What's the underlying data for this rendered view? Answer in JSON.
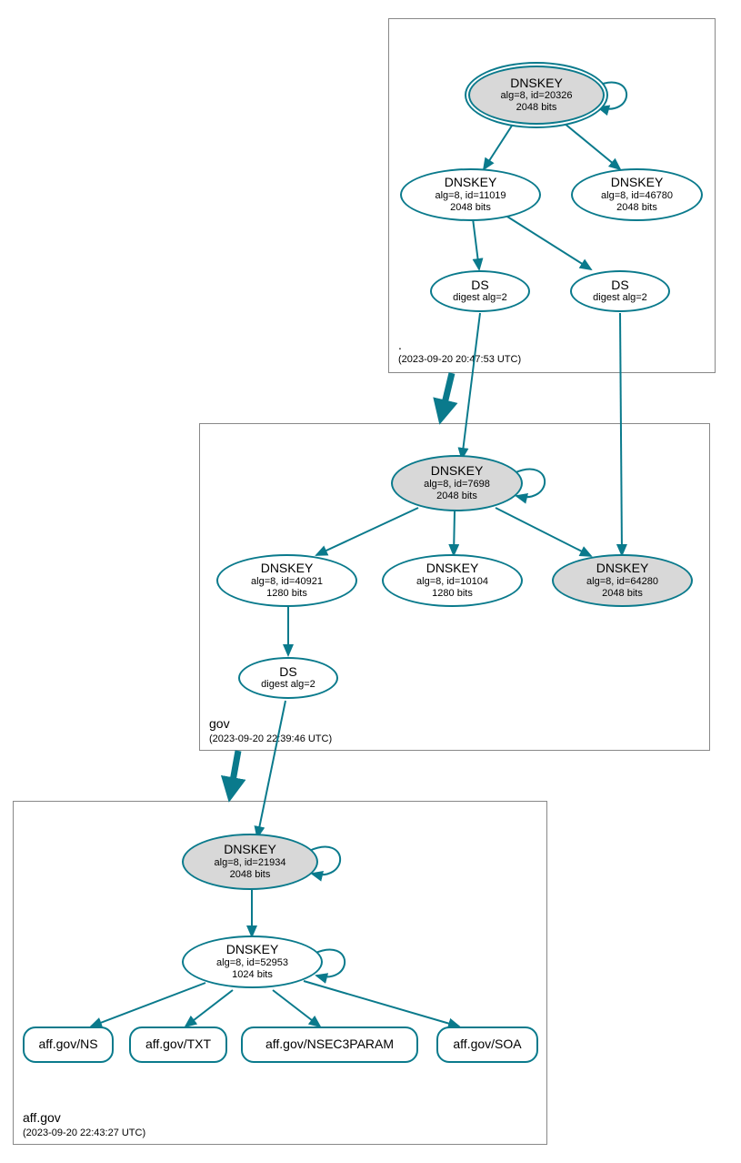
{
  "zones": {
    "root": {
      "label": ".",
      "time": "(2023-09-20 20:47:53 UTC)"
    },
    "gov": {
      "label": "gov",
      "time": "(2023-09-20 22:39:46 UTC)"
    },
    "aff": {
      "label": "aff.gov",
      "time": "(2023-09-20 22:43:27 UTC)"
    }
  },
  "nodes": {
    "root_ksk": {
      "title": "DNSKEY",
      "sub1": "alg=8, id=20326",
      "sub2": "2048 bits"
    },
    "root_zsk1": {
      "title": "DNSKEY",
      "sub1": "alg=8, id=11019",
      "sub2": "2048 bits"
    },
    "root_zsk2": {
      "title": "DNSKEY",
      "sub1": "alg=8, id=46780",
      "sub2": "2048 bits"
    },
    "root_ds1": {
      "title": "DS",
      "sub1": "digest alg=2"
    },
    "root_ds2": {
      "title": "DS",
      "sub1": "digest alg=2"
    },
    "gov_ksk": {
      "title": "DNSKEY",
      "sub1": "alg=8, id=7698",
      "sub2": "2048 bits"
    },
    "gov_zsk1": {
      "title": "DNSKEY",
      "sub1": "alg=8, id=40921",
      "sub2": "1280 bits"
    },
    "gov_zsk2": {
      "title": "DNSKEY",
      "sub1": "alg=8, id=10104",
      "sub2": "1280 bits"
    },
    "gov_zsk3": {
      "title": "DNSKEY",
      "sub1": "alg=8, id=64280",
      "sub2": "2048 bits"
    },
    "gov_ds": {
      "title": "DS",
      "sub1": "digest alg=2"
    },
    "aff_ksk": {
      "title": "DNSKEY",
      "sub1": "alg=8, id=21934",
      "sub2": "2048 bits"
    },
    "aff_zsk": {
      "title": "DNSKEY",
      "sub1": "alg=8, id=52953",
      "sub2": "1024 bits"
    },
    "rr_ns": {
      "title": "aff.gov/NS"
    },
    "rr_txt": {
      "title": "aff.gov/TXT"
    },
    "rr_nsec3": {
      "title": "aff.gov/NSEC3PARAM"
    },
    "rr_soa": {
      "title": "aff.gov/SOA"
    }
  }
}
